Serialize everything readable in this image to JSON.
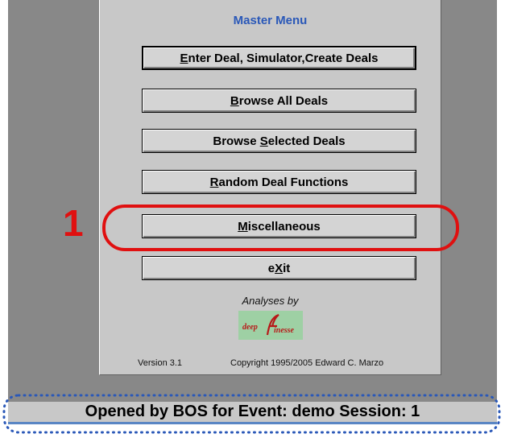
{
  "window": {
    "title": "Master Menu"
  },
  "menu": {
    "buttons": [
      {
        "label": "Enter Deal, Simulator,Create Deals",
        "mnemonic": "E"
      },
      {
        "label": "Browse All Deals",
        "mnemonic": "B"
      },
      {
        "label": "Browse Selected Deals",
        "mnemonic": "S"
      },
      {
        "label": "Random Deal Functions",
        "mnemonic": "R"
      },
      {
        "label": "Miscellaneous",
        "mnemonic": "M"
      },
      {
        "label": "eXit",
        "mnemonic": "X"
      }
    ]
  },
  "branding": {
    "analyses_label": "Analyses by",
    "logo_text": "deepfinesse",
    "logo_icon": "deep-finesse-logo"
  },
  "footer": {
    "version": "Version 3.1",
    "copyright": "Copyright 1995/2005 Edward C. Marzo"
  },
  "status_bar": {
    "text": "Opened by BOS for Event: demo  Session: 1"
  },
  "annotations": {
    "callout_number": "1",
    "highlight_color": "#e01010",
    "status_highlight_color": "#2a58b8"
  },
  "colors": {
    "title_blue": "#2a58b8",
    "panel_gray": "#c8c8c8",
    "desktop_gray": "#888888"
  }
}
